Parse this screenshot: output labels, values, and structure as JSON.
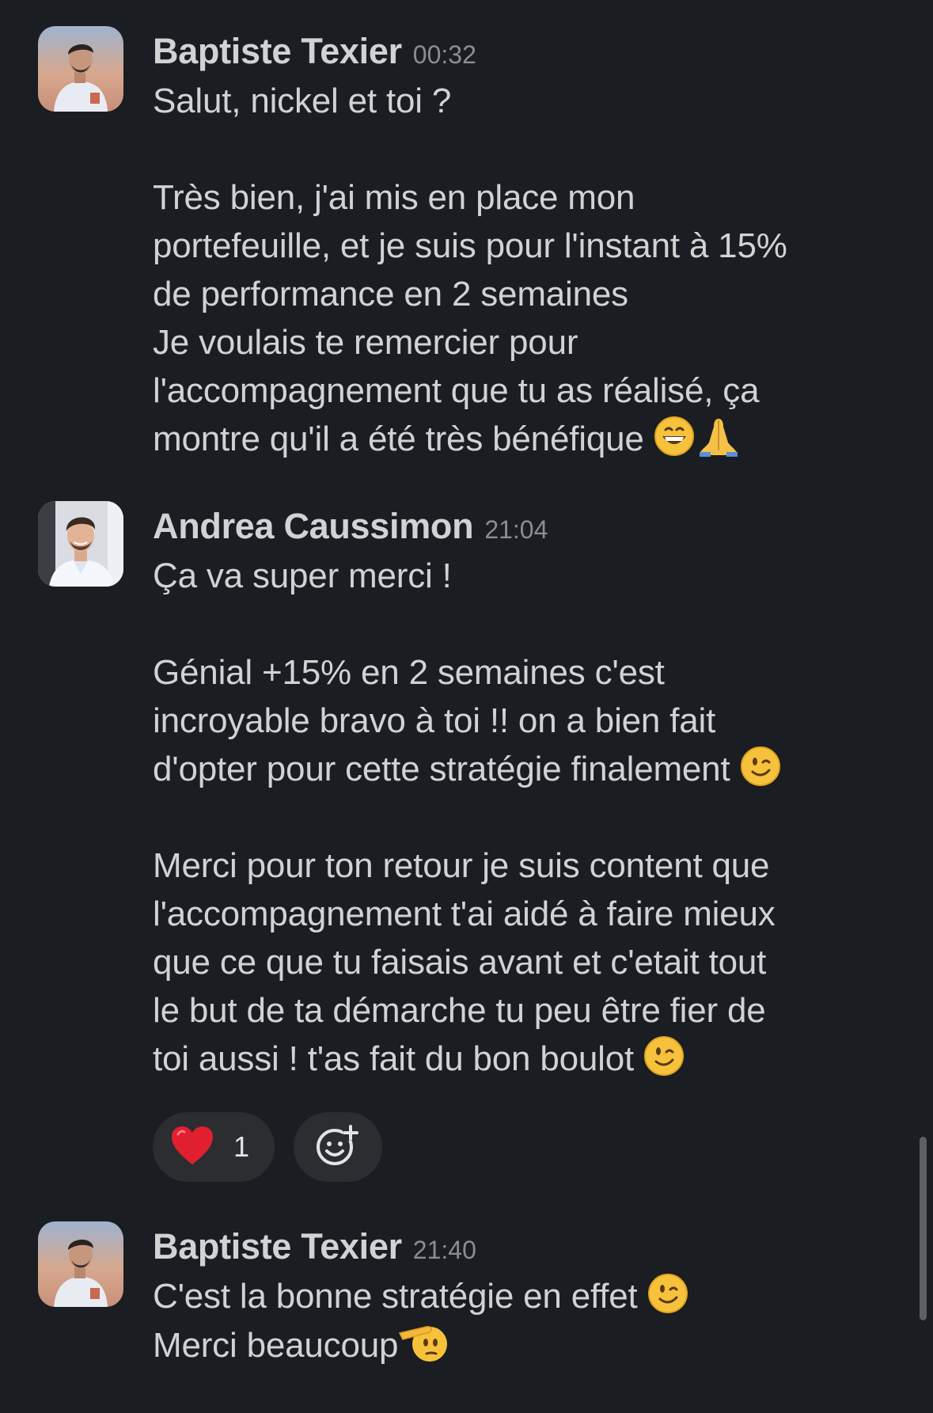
{
  "messages": [
    {
      "sender": "Baptiste Texier",
      "time": "00:32",
      "paragraphs": [
        "Salut, nickel et toi ?",
        "Très bien, j'ai mis en place mon\nportefeuille, et je suis pour l'instant à 15%\nde performance en 2 semaines\nJe voulais te remercier pour\nl'accompagnement que tu as réalisé, ça\nmontre qu'il a été très bénéfique"
      ],
      "trailing_emojis": [
        "grinning-face-emoji",
        "folded-hands-emoji"
      ]
    },
    {
      "sender": "Andrea Caussimon",
      "time": "21:04",
      "paragraphs": [
        "Ça va super merci !",
        "Génial +15% en 2 semaines c'est\nincroyable bravo à toi !! on a bien fait\nd'opter pour cette stratégie finalement",
        "Merci pour ton retour je suis content que\nl'accompagnement t'ai aidé à faire mieux\nque ce que tu faisais avant et c'etait tout\nle but de ta démarche tu peu être fier de\ntoi aussi ! t'as fait du bon boulot"
      ],
      "reactions": [
        {
          "icon": "red-heart-emoji",
          "count": "1"
        }
      ]
    },
    {
      "sender": "Baptiste Texier",
      "time": "21:40",
      "lines": [
        "C'est la bonne stratégie en effet",
        "Merci beaucoup"
      ]
    }
  ],
  "icons": {
    "add_reaction": "add-reaction-icon",
    "winking": "winking-face-emoji",
    "saluting": "saluting-face-emoji"
  },
  "colors": {
    "background": "#1a1d21",
    "text": "#d1d2d3",
    "timestamp": "#8b8d90",
    "reaction_pill": "#2b2d31"
  }
}
